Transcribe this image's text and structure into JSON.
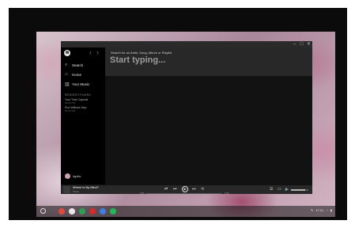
{
  "window": {
    "controls": [
      "–",
      "□",
      "✕"
    ]
  },
  "sidebar": {
    "logo_glyph": "≋",
    "nav": [
      {
        "label": "Search",
        "icon": "search-icon"
      },
      {
        "label": "Home",
        "icon": "home-icon"
      },
      {
        "label": "Your Music",
        "icon": "library-icon"
      }
    ],
    "section_label": "RECENTLY PLAYED",
    "playlists": [
      {
        "name": "Your Time Capsule",
        "sub": "PLAYLIST"
      },
      {
        "name": "Run Without Stop",
        "sub": "PLAYLIST"
      }
    ],
    "user": {
      "name": "kgdiw"
    }
  },
  "search": {
    "hint": "Search for an Artist, Song, Album or Playlist",
    "placeholder": "Start typing..."
  },
  "player": {
    "track_title": "Where Is My Mind?",
    "track_artist": "Pixies",
    "elapsed": "0:00",
    "duration": "3:49",
    "progress_fraction": 0.0,
    "volume_fraction": 0.8
  },
  "shelf": {
    "clock": "17:21",
    "apps": [
      {
        "name": "chrome",
        "color": "#e04a3a"
      },
      {
        "name": "gmail",
        "color": "#e8e8e8"
      },
      {
        "name": "drive",
        "color": "#2e9e54"
      },
      {
        "name": "youtube",
        "color": "#d92b2b"
      },
      {
        "name": "files",
        "color": "#3f7fe0"
      },
      {
        "name": "spotify",
        "color": "#1db954"
      }
    ]
  },
  "colors": {
    "accent": "#1db954",
    "background": "#121212"
  }
}
